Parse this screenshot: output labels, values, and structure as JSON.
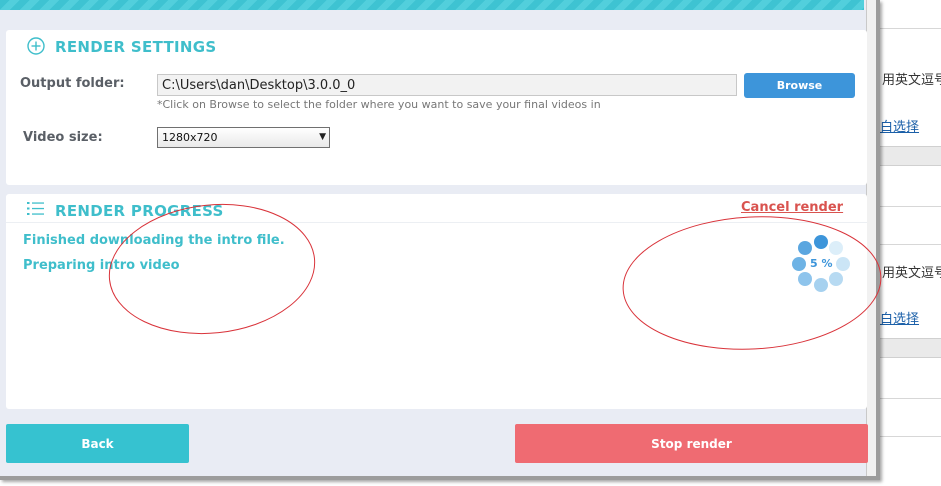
{
  "background_window": {
    "text_row_1": "用英文逗号",
    "link_1": "白选择",
    "text_row_2": "用英文逗号",
    "link_2": "白选择"
  },
  "render_settings": {
    "title": "RENDER SETTINGS",
    "icon": "plus-circle-icon",
    "output_folder_label": "Output folder:",
    "output_folder_value": "C:\\Users\\dan\\Desktop\\3.0.0_0",
    "browse_label": "Browse",
    "output_hint": "*Click on Browse to select the folder where you want to save your final videos in",
    "video_size_label": "Video size:",
    "video_size_value": "1280x720"
  },
  "render_progress": {
    "title": "RENDER PROGRESS",
    "icon": "list-icon",
    "cancel_label": "Cancel render",
    "status_lines": [
      "Finished downloading the intro file.",
      "Preparing intro video"
    ],
    "progress_percent_label": "5 %",
    "progress_percent": 5
  },
  "footer": {
    "back_label": "Back",
    "stop_label": "Stop render"
  },
  "colors": {
    "accent_teal": "#3fbecb",
    "button_blue": "#3d95da",
    "stop_red": "#ef6b72",
    "cancel_red": "#d9534f",
    "annotation_red": "#d9333a"
  }
}
